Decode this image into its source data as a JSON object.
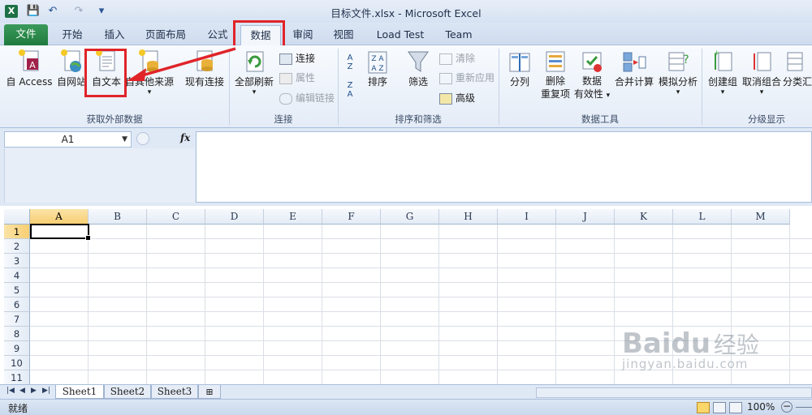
{
  "window": {
    "title": "目标文件.xlsx - Microsoft Excel",
    "app_icon": "X"
  },
  "quick_access": {
    "save": "💾",
    "undo": "↶",
    "redo": "↷",
    "customize": "▾"
  },
  "tabs": [
    {
      "label": "文件"
    },
    {
      "label": "开始"
    },
    {
      "label": "插入"
    },
    {
      "label": "页面布局"
    },
    {
      "label": "公式"
    },
    {
      "label": "数据"
    },
    {
      "label": "审阅"
    },
    {
      "label": "视图"
    },
    {
      "label": "Load Test"
    },
    {
      "label": "Team"
    }
  ],
  "ribbon": {
    "external": {
      "label": "获取外部数据",
      "access": "自 Access",
      "web": "自网站",
      "text": "自文本",
      "other": "自其他来源",
      "existing": "现有连接"
    },
    "connections": {
      "label": "连接",
      "refresh_all": "全部刷新",
      "connections": "连接",
      "properties": "属性",
      "edit_links": "编辑链接"
    },
    "sort_filter": {
      "label": "排序和筛选",
      "sort": "排序",
      "filter": "筛选",
      "clear": "清除",
      "reapply": "重新应用",
      "advanced": "高级",
      "az": "A\nZ",
      "za": "Z\nA"
    },
    "data_tools": {
      "label": "数据工具",
      "split": "分列",
      "remove_dup_1": "删除",
      "remove_dup_2": "重复项",
      "validation_1": "数据",
      "validation_2": "有效性",
      "consolidate": "合并计算",
      "whatif": "模拟分析"
    },
    "outline": {
      "label": "分级显示",
      "group": "创建组",
      "ungroup": "取消组合",
      "subtotal": "分类汇"
    }
  },
  "formula_bar": {
    "name_box": "A1",
    "fx": "fx",
    "formula": ""
  },
  "grid": {
    "columns": [
      "A",
      "B",
      "C",
      "D",
      "E",
      "F",
      "G",
      "H",
      "I",
      "J",
      "K",
      "L",
      "M"
    ],
    "rows": [
      "1",
      "2",
      "3",
      "4",
      "5",
      "6",
      "7",
      "8",
      "9",
      "10",
      "11"
    ],
    "active_cell": "A1"
  },
  "sheets": [
    {
      "label": "Sheet1"
    },
    {
      "label": "Sheet2"
    },
    {
      "label": "Sheet3"
    }
  ],
  "status": {
    "ready": "就绪",
    "zoom": "100%"
  },
  "watermark": {
    "brand": "Bai",
    "brand2": "du",
    "cn": "经验",
    "url": "jingyan.baidu.com"
  },
  "colors": {
    "annotation_red": "#e0242a",
    "file_tab_green": "#1f7a3e",
    "selected_header": "#f7cf73"
  }
}
